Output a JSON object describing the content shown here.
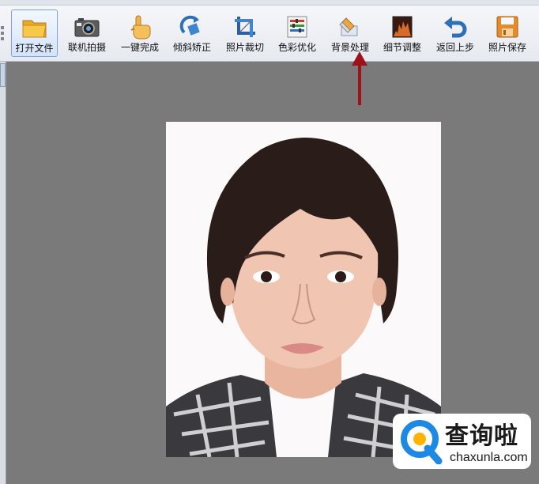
{
  "toolbar": {
    "buttons": [
      {
        "label": "打开文件",
        "icon": "folder-open-icon",
        "active": true
      },
      {
        "label": "联机拍摄",
        "icon": "camera-icon"
      },
      {
        "label": "一键完成",
        "icon": "hand-click-icon"
      },
      {
        "label": "倾斜矫正",
        "icon": "rotate-correct-icon"
      },
      {
        "label": "照片裁切",
        "icon": "crop-icon"
      },
      {
        "label": "色彩优化",
        "icon": "color-adjust-icon"
      },
      {
        "label": "背景处理",
        "icon": "eraser-brush-icon"
      },
      {
        "label": "细节调整",
        "icon": "histogram-icon"
      },
      {
        "label": "返回上步",
        "icon": "undo-icon"
      },
      {
        "label": "照片保存",
        "icon": "save-disk-icon"
      }
    ]
  },
  "watermark": {
    "title": "查询啦",
    "url": "chaxunla.com",
    "brand_color": "#1e88e5"
  },
  "colors": {
    "canvas_bg": "#7a7a7a",
    "arrow": "#a0121a"
  }
}
